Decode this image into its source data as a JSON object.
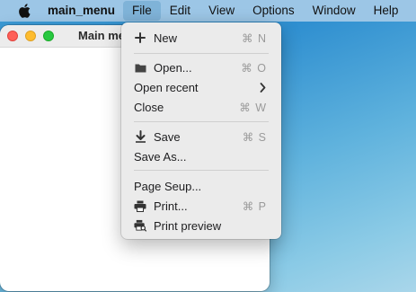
{
  "menubar": {
    "app_name": "main_menu",
    "items": [
      "File",
      "Edit",
      "View",
      "Options",
      "Window",
      "Help"
    ],
    "active_item": "File"
  },
  "window": {
    "title": "Main me"
  },
  "file_menu": {
    "new": {
      "label": "New",
      "shortcut": "⌘ N",
      "icon": "plus-icon"
    },
    "open": {
      "label": "Open...",
      "shortcut": "⌘ O",
      "icon": "folder-icon"
    },
    "open_recent": {
      "label": "Open recent",
      "icon": "chevron-right-icon"
    },
    "close": {
      "label": "Close",
      "shortcut": "⌘ W"
    },
    "save": {
      "label": "Save",
      "shortcut": "⌘ S",
      "icon": "download-icon"
    },
    "save_as": {
      "label": "Save As..."
    },
    "page_setup": {
      "label": "Page Seup..."
    },
    "print": {
      "label": "Print...",
      "shortcut": "⌘ P",
      "icon": "printer-icon"
    },
    "print_preview": {
      "label": "Print preview",
      "icon": "print-preview-icon"
    }
  },
  "colors": {
    "menubar": "#9cc6e6",
    "close": "#fe5f57",
    "minimize": "#febc2e",
    "maximize": "#28c840"
  }
}
